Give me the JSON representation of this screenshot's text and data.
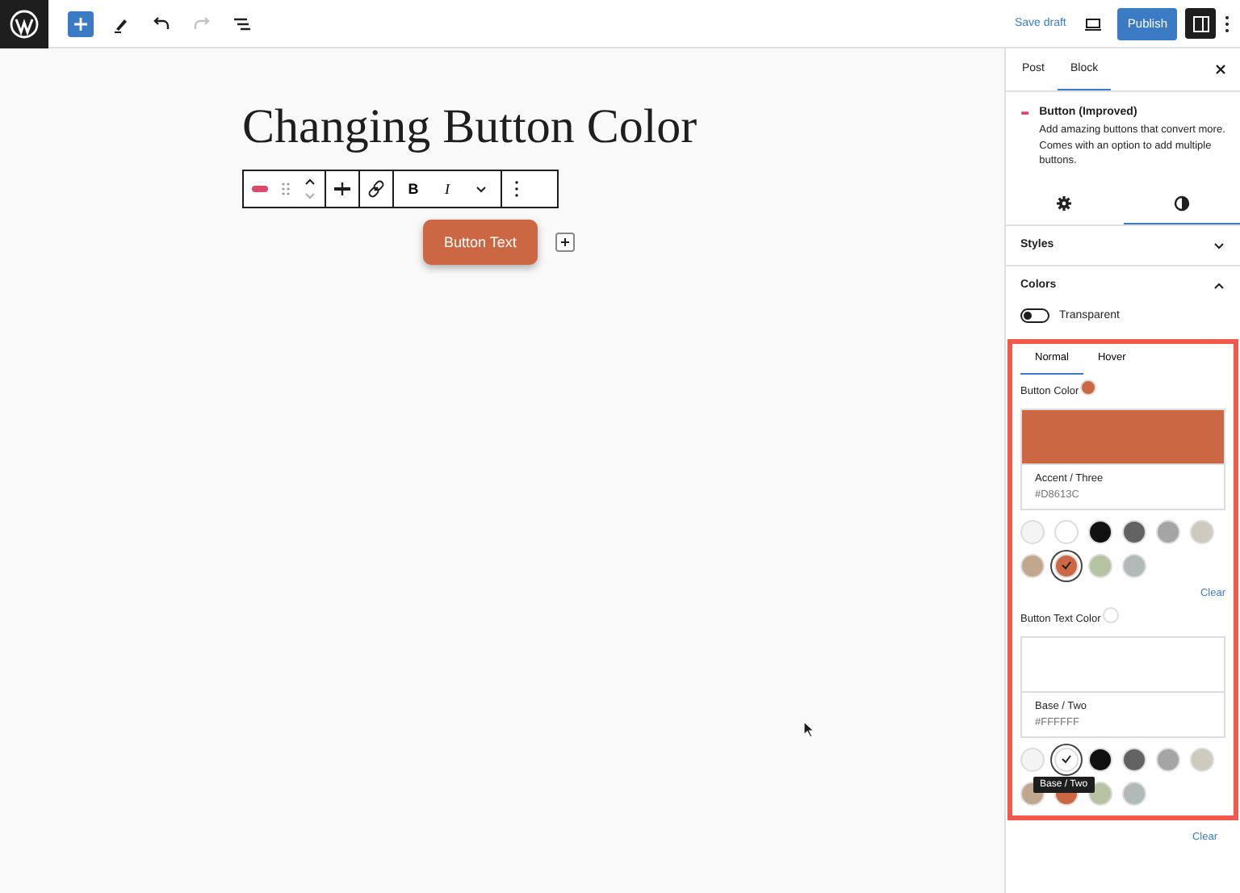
{
  "topbar": {
    "tools": [
      {
        "kind": "add",
        "disabled": false
      },
      {
        "kind": "edit",
        "disabled": false
      },
      {
        "kind": "undo",
        "disabled": false
      },
      {
        "kind": "redo",
        "disabled": true
      },
      {
        "kind": "list",
        "disabled": false
      }
    ],
    "save_draft": "Save draft",
    "publish": "Publish",
    "settings_pressed": true
  },
  "editor": {
    "title": "Changing Button Color",
    "format": [
      "B",
      "I"
    ],
    "button_text": "Button Text"
  },
  "sidebar": {
    "tabs": [
      {
        "label": "Post",
        "selected": false
      },
      {
        "label": "Block",
        "selected": true
      }
    ],
    "block": {
      "name": "Button (Improved)",
      "description": "Add amazing buttons that convert more. Comes with an option to add multiple buttons."
    },
    "inspector_tabs": [
      {
        "kind": "settings",
        "selected": false
      },
      {
        "kind": "styles",
        "selected": true
      }
    ],
    "panels": [
      {
        "title": "Styles",
        "expanded": false
      },
      {
        "title": "Colors",
        "expanded": true
      }
    ],
    "toggle": {
      "label": "Transparent",
      "on": false
    },
    "state_tabs": [
      {
        "label": "Normal",
        "selected": true
      },
      {
        "label": "Hover",
        "selected": false
      }
    ],
    "color_settings": [
      {
        "label": "Button Color",
        "color": "#cb6843",
        "name": "Accent / Three",
        "hex": "#D8613C",
        "clear": "Clear",
        "swatches": [
          {
            "color": "#f4f4f4",
            "selected": false
          },
          {
            "color": "#ffffff",
            "selected": false
          },
          {
            "color": "#111111",
            "selected": false
          },
          {
            "color": "#636363",
            "selected": false
          },
          {
            "color": "#a5a5a5",
            "selected": false
          },
          {
            "color": "#cfcabe",
            "selected": false
          },
          {
            "color": "#c1a78d",
            "selected": false
          },
          {
            "color": "#cb6843",
            "selected": true
          },
          {
            "color": "#b6c4a3",
            "selected": false
          },
          {
            "color": "#b1b9b9",
            "selected": false
          }
        ]
      },
      {
        "label": "Button Text Color",
        "color": "#ffffff",
        "name": "Base / Two",
        "hex": "#FFFFFF",
        "clear": "Clear",
        "tooltip": "Base / Two",
        "swatches": [
          {
            "color": "#f4f4f4",
            "selected": false
          },
          {
            "color": "#ffffff",
            "selected": true
          },
          {
            "color": "#111111",
            "selected": false
          },
          {
            "color": "#636363",
            "selected": false
          },
          {
            "color": "#a5a5a5",
            "selected": false
          },
          {
            "color": "#cfcabe",
            "selected": false
          },
          {
            "color": "#c1a78d",
            "selected": false
          },
          {
            "color": "#cb6843",
            "selected": false
          },
          {
            "color": "#b6c4a3",
            "selected": false
          },
          {
            "color": "#b1b9b9",
            "selected": false
          }
        ]
      }
    ]
  }
}
